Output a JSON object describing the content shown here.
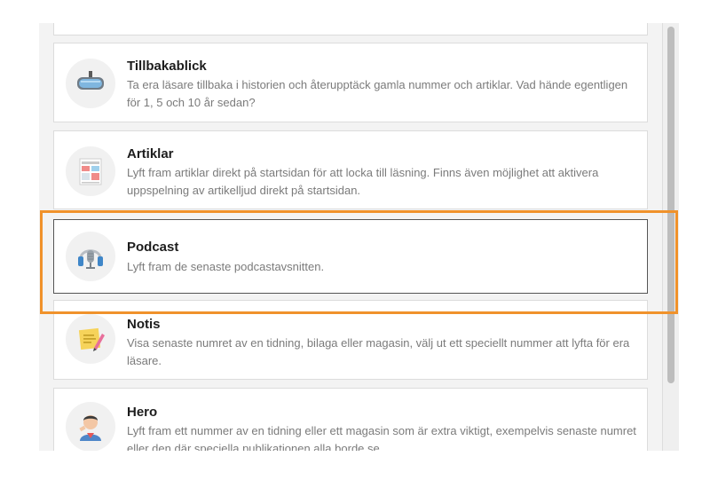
{
  "cards": [
    {
      "id": "tillbakablick",
      "title": "Tillbakablick",
      "description": "Ta era läsare tillbaka i historien och återupptäck gamla nummer och artiklar. Vad hände egentligen för 1, 5 och 10 år sedan?",
      "icon": "rearview-mirror-icon"
    },
    {
      "id": "artiklar",
      "title": "Artiklar",
      "description": "Lyft fram artiklar direkt på startsidan för att locka till läsning. Finns även möjlighet att aktivera uppspelning av artikelljud direkt på startsidan.",
      "icon": "article-layout-icon"
    },
    {
      "id": "podcast",
      "title": "Podcast",
      "description": "Lyft fram de senaste podcastavsnitten.",
      "icon": "podcast-microphone-icon",
      "selected": true
    },
    {
      "id": "notis",
      "title": "Notis",
      "description": "Visa senaste numret av en tidning, bilaga eller magasin, välj ut ett speciellt nummer att lyfta för era läsare.",
      "icon": "sticky-note-icon"
    },
    {
      "id": "hero",
      "title": "Hero",
      "description": "Lyft fram ett nummer av en tidning eller ett magasin som är extra viktigt, exempelvis senaste numret eller den där speciella publikationen alla borde se.",
      "icon": "hero-person-icon"
    }
  ],
  "colors": {
    "highlight": "#f0922b",
    "title": "#1d1d1d",
    "description": "#7b7b7b"
  }
}
